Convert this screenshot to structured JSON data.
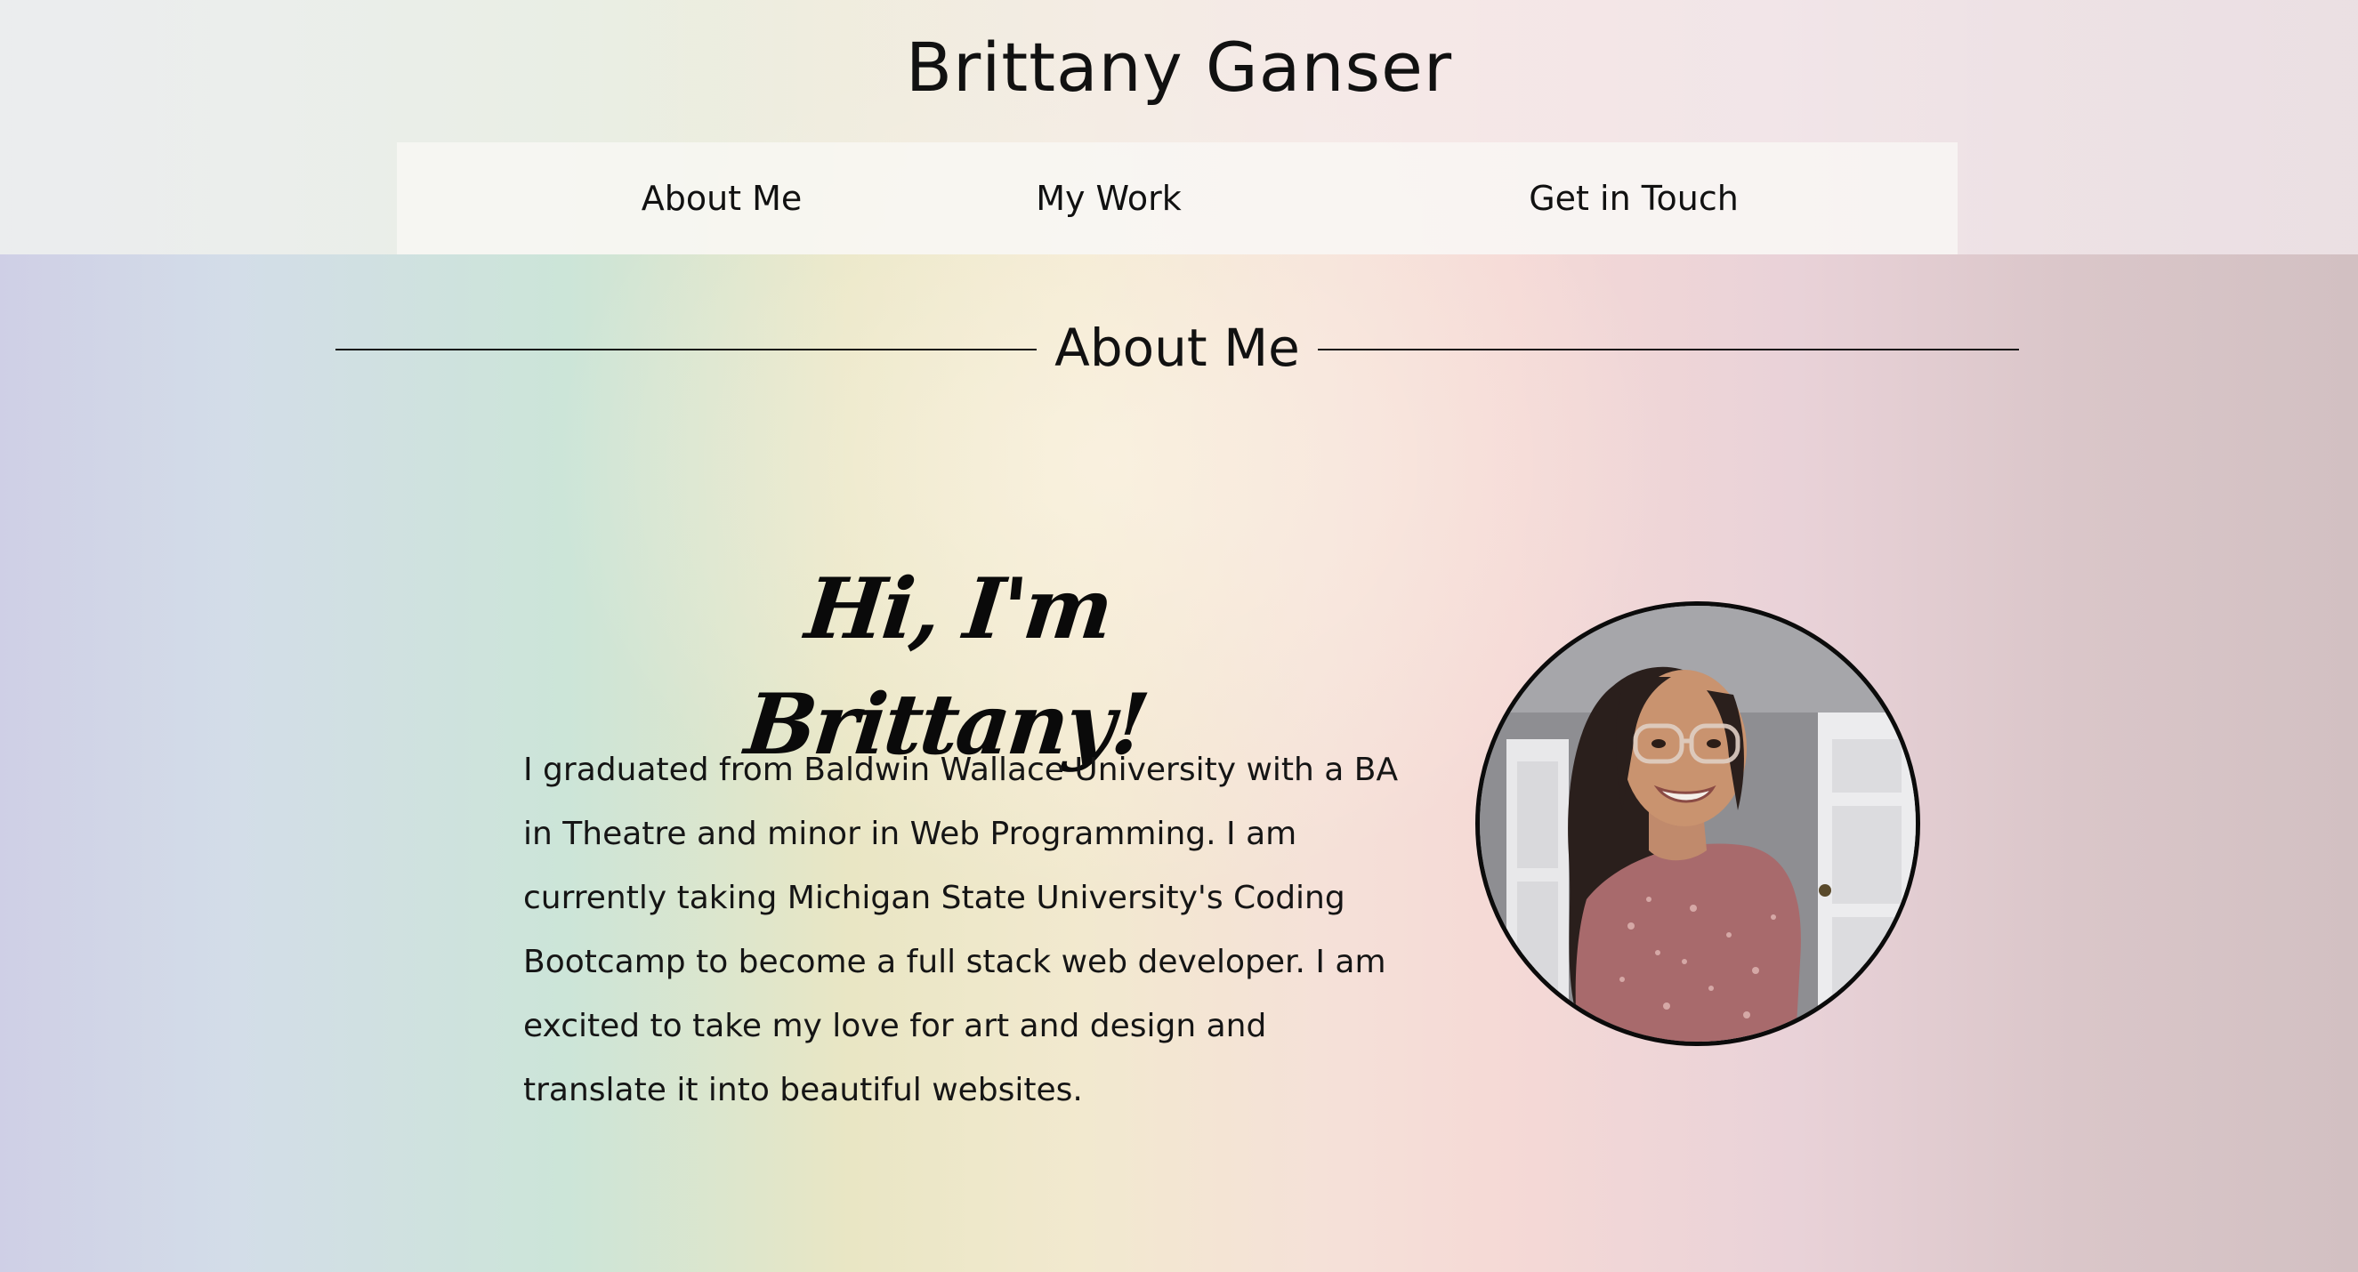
{
  "site": {
    "title": "Brittany Ganser"
  },
  "nav": {
    "items": [
      {
        "label": "About Me"
      },
      {
        "label": "My Work"
      },
      {
        "label": "Get in Touch"
      }
    ]
  },
  "about": {
    "section_title": "About Me",
    "greeting": "Hi, I'm Brittany!",
    "bio": "I graduated from Baldwin Wallace University with a BA in Theatre and minor in Web Programming. I am currently taking Michigan State University's Coding Bootcamp to become a full stack web developer. I am excited to take my love for art and design and translate it into beautiful websites.",
    "bio_lines": [
      "I graduated from Baldwin Wallace University with a BA",
      "in Theatre and minor in Web Programming. I am",
      "currently taking Michigan State University's Coding",
      "Bootcamp to become a full stack web developer. I am",
      "excited to take my love for art and design and",
      "translate it into beautiful websites."
    ],
    "photo_icon": "profile-photo"
  },
  "colors": {
    "text": "#111111",
    "photo_border": "#0b0b0b"
  }
}
